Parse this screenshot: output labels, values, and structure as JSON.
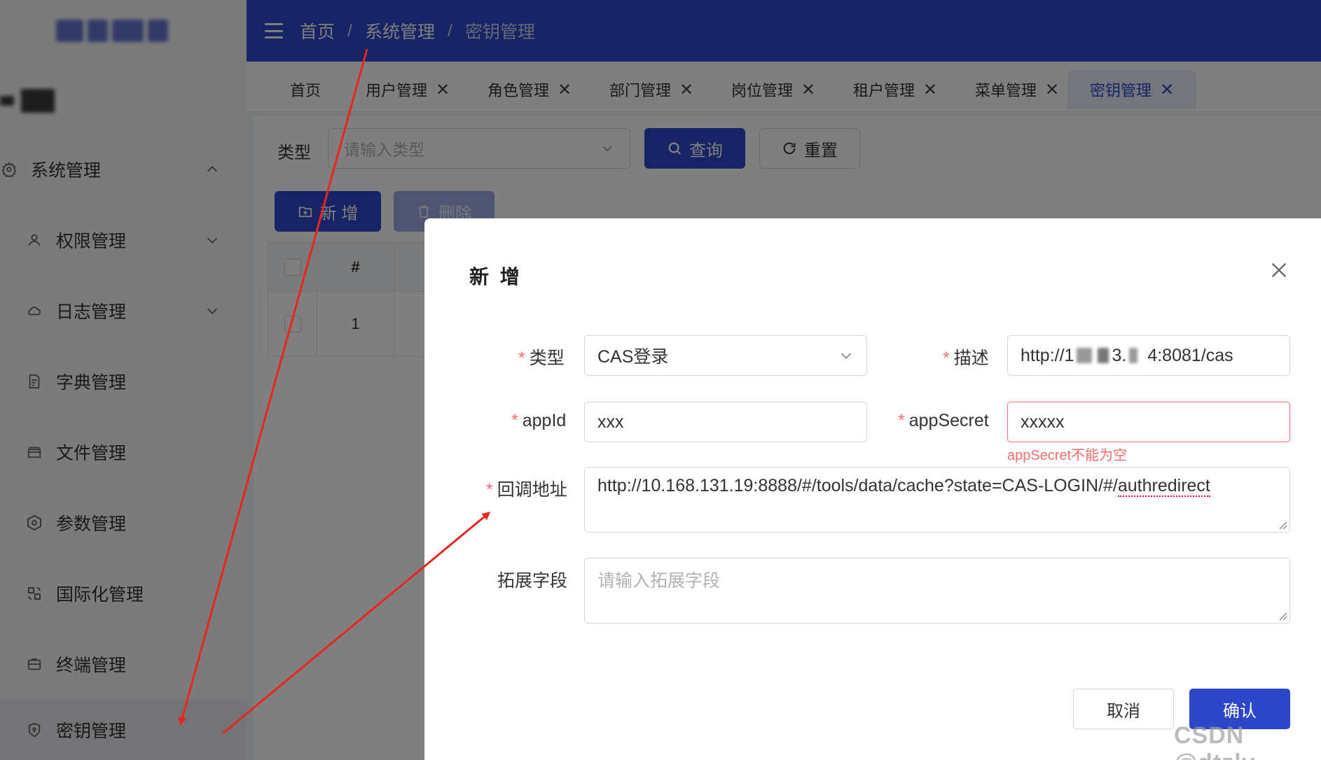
{
  "sidebar": {
    "items": [
      {
        "label": "系统管理",
        "icon": "gear-icon",
        "chevron": "up"
      },
      {
        "label": "权限管理",
        "icon": "user-icon",
        "chevron": "down"
      },
      {
        "label": "日志管理",
        "icon": "cloud-icon",
        "chevron": "down"
      },
      {
        "label": "字典管理",
        "icon": "dictionary-icon"
      },
      {
        "label": "文件管理",
        "icon": "file-icon"
      },
      {
        "label": "参数管理",
        "icon": "parameter-icon"
      },
      {
        "label": "国际化管理",
        "icon": "globe-icon"
      },
      {
        "label": "终端管理",
        "icon": "terminal-icon"
      },
      {
        "label": "密钥管理",
        "icon": "shield-icon",
        "active": true
      }
    ]
  },
  "header": {
    "breadcrumb": [
      "首页",
      "系统管理",
      "密钥管理"
    ],
    "separator": "/",
    "bg_color": "#2d47c8"
  },
  "tabs": [
    {
      "label": "首页",
      "closable": false
    },
    {
      "label": "用户管理",
      "closable": true
    },
    {
      "label": "角色管理",
      "closable": true
    },
    {
      "label": "部门管理",
      "closable": true
    },
    {
      "label": "岗位管理",
      "closable": true
    },
    {
      "label": "租户管理",
      "closable": true
    },
    {
      "label": "菜单管理",
      "closable": true
    },
    {
      "label": "密钥管理",
      "closable": true,
      "active": true
    }
  ],
  "tab_close_glyph": "✕",
  "filter": {
    "type_label": "类型",
    "type_placeholder": "请输入类型",
    "search_label": "查询",
    "reset_label": "重置"
  },
  "toolbar": {
    "add_label": "新 增",
    "delete_label": "删除"
  },
  "table": {
    "header_num": "#",
    "rows": [
      {
        "num": "1"
      }
    ]
  },
  "modal": {
    "title": "新 增",
    "required_mark": "*",
    "fields": {
      "type": {
        "label": "类型",
        "value": "CAS登录"
      },
      "desc": {
        "label": "描述",
        "value_prefix": "http://1",
        "value_mid": "3.",
        "value_suffix": "4:8081/cas"
      },
      "appid": {
        "label": "appId",
        "value": "xxx"
      },
      "appsecret": {
        "label": "appSecret",
        "value": "xxxxx",
        "error": "appSecret不能为空"
      },
      "callback": {
        "label": "回调地址",
        "value_main": "http://10.168.131.19:8888/#/tools/data/cache?state=CAS-LOGIN/#/",
        "value_tail": "authredirect"
      },
      "ext": {
        "label": "拓展字段",
        "placeholder": "请输入拓展字段"
      }
    },
    "cancel_label": "取消",
    "confirm_label": "确认"
  },
  "watermark": "CSDN @dtzly",
  "colors": {
    "primary": "#2d47c8",
    "error": "#f56c6c",
    "annotation_arrow": "#e8261f"
  }
}
